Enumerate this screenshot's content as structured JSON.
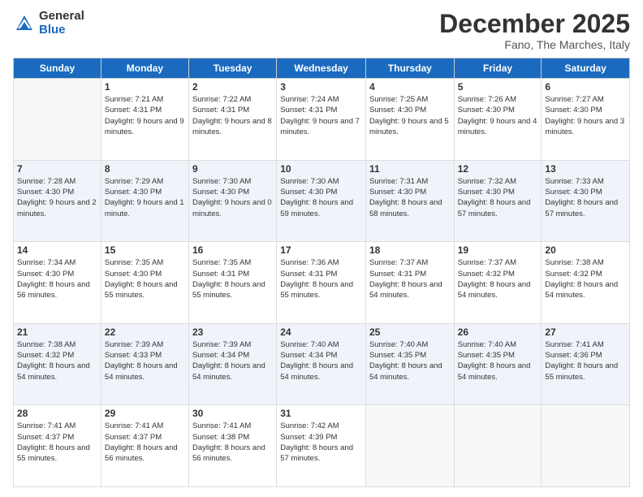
{
  "logo": {
    "general": "General",
    "blue": "Blue"
  },
  "header": {
    "month": "December 2025",
    "location": "Fano, The Marches, Italy"
  },
  "weekdays": [
    "Sunday",
    "Monday",
    "Tuesday",
    "Wednesday",
    "Thursday",
    "Friday",
    "Saturday"
  ],
  "weeks": [
    [
      {
        "day": "",
        "sunrise": "",
        "sunset": "",
        "daylight": ""
      },
      {
        "day": "1",
        "sunrise": "Sunrise: 7:21 AM",
        "sunset": "Sunset: 4:31 PM",
        "daylight": "Daylight: 9 hours and 9 minutes."
      },
      {
        "day": "2",
        "sunrise": "Sunrise: 7:22 AM",
        "sunset": "Sunset: 4:31 PM",
        "daylight": "Daylight: 9 hours and 8 minutes."
      },
      {
        "day": "3",
        "sunrise": "Sunrise: 7:24 AM",
        "sunset": "Sunset: 4:31 PM",
        "daylight": "Daylight: 9 hours and 7 minutes."
      },
      {
        "day": "4",
        "sunrise": "Sunrise: 7:25 AM",
        "sunset": "Sunset: 4:30 PM",
        "daylight": "Daylight: 9 hours and 5 minutes."
      },
      {
        "day": "5",
        "sunrise": "Sunrise: 7:26 AM",
        "sunset": "Sunset: 4:30 PM",
        "daylight": "Daylight: 9 hours and 4 minutes."
      },
      {
        "day": "6",
        "sunrise": "Sunrise: 7:27 AM",
        "sunset": "Sunset: 4:30 PM",
        "daylight": "Daylight: 9 hours and 3 minutes."
      }
    ],
    [
      {
        "day": "7",
        "sunrise": "Sunrise: 7:28 AM",
        "sunset": "Sunset: 4:30 PM",
        "daylight": "Daylight: 9 hours and 2 minutes."
      },
      {
        "day": "8",
        "sunrise": "Sunrise: 7:29 AM",
        "sunset": "Sunset: 4:30 PM",
        "daylight": "Daylight: 9 hours and 1 minute."
      },
      {
        "day": "9",
        "sunrise": "Sunrise: 7:30 AM",
        "sunset": "Sunset: 4:30 PM",
        "daylight": "Daylight: 9 hours and 0 minutes."
      },
      {
        "day": "10",
        "sunrise": "Sunrise: 7:30 AM",
        "sunset": "Sunset: 4:30 PM",
        "daylight": "Daylight: 8 hours and 59 minutes."
      },
      {
        "day": "11",
        "sunrise": "Sunrise: 7:31 AM",
        "sunset": "Sunset: 4:30 PM",
        "daylight": "Daylight: 8 hours and 58 minutes."
      },
      {
        "day": "12",
        "sunrise": "Sunrise: 7:32 AM",
        "sunset": "Sunset: 4:30 PM",
        "daylight": "Daylight: 8 hours and 57 minutes."
      },
      {
        "day": "13",
        "sunrise": "Sunrise: 7:33 AM",
        "sunset": "Sunset: 4:30 PM",
        "daylight": "Daylight: 8 hours and 57 minutes."
      }
    ],
    [
      {
        "day": "14",
        "sunrise": "Sunrise: 7:34 AM",
        "sunset": "Sunset: 4:30 PM",
        "daylight": "Daylight: 8 hours and 56 minutes."
      },
      {
        "day": "15",
        "sunrise": "Sunrise: 7:35 AM",
        "sunset": "Sunset: 4:30 PM",
        "daylight": "Daylight: 8 hours and 55 minutes."
      },
      {
        "day": "16",
        "sunrise": "Sunrise: 7:35 AM",
        "sunset": "Sunset: 4:31 PM",
        "daylight": "Daylight: 8 hours and 55 minutes."
      },
      {
        "day": "17",
        "sunrise": "Sunrise: 7:36 AM",
        "sunset": "Sunset: 4:31 PM",
        "daylight": "Daylight: 8 hours and 55 minutes."
      },
      {
        "day": "18",
        "sunrise": "Sunrise: 7:37 AM",
        "sunset": "Sunset: 4:31 PM",
        "daylight": "Daylight: 8 hours and 54 minutes."
      },
      {
        "day": "19",
        "sunrise": "Sunrise: 7:37 AM",
        "sunset": "Sunset: 4:32 PM",
        "daylight": "Daylight: 8 hours and 54 minutes."
      },
      {
        "day": "20",
        "sunrise": "Sunrise: 7:38 AM",
        "sunset": "Sunset: 4:32 PM",
        "daylight": "Daylight: 8 hours and 54 minutes."
      }
    ],
    [
      {
        "day": "21",
        "sunrise": "Sunrise: 7:38 AM",
        "sunset": "Sunset: 4:32 PM",
        "daylight": "Daylight: 8 hours and 54 minutes."
      },
      {
        "day": "22",
        "sunrise": "Sunrise: 7:39 AM",
        "sunset": "Sunset: 4:33 PM",
        "daylight": "Daylight: 8 hours and 54 minutes."
      },
      {
        "day": "23",
        "sunrise": "Sunrise: 7:39 AM",
        "sunset": "Sunset: 4:34 PM",
        "daylight": "Daylight: 8 hours and 54 minutes."
      },
      {
        "day": "24",
        "sunrise": "Sunrise: 7:40 AM",
        "sunset": "Sunset: 4:34 PM",
        "daylight": "Daylight: 8 hours and 54 minutes."
      },
      {
        "day": "25",
        "sunrise": "Sunrise: 7:40 AM",
        "sunset": "Sunset: 4:35 PM",
        "daylight": "Daylight: 8 hours and 54 minutes."
      },
      {
        "day": "26",
        "sunrise": "Sunrise: 7:40 AM",
        "sunset": "Sunset: 4:35 PM",
        "daylight": "Daylight: 8 hours and 54 minutes."
      },
      {
        "day": "27",
        "sunrise": "Sunrise: 7:41 AM",
        "sunset": "Sunset: 4:36 PM",
        "daylight": "Daylight: 8 hours and 55 minutes."
      }
    ],
    [
      {
        "day": "28",
        "sunrise": "Sunrise: 7:41 AM",
        "sunset": "Sunset: 4:37 PM",
        "daylight": "Daylight: 8 hours and 55 minutes."
      },
      {
        "day": "29",
        "sunrise": "Sunrise: 7:41 AM",
        "sunset": "Sunset: 4:37 PM",
        "daylight": "Daylight: 8 hours and 56 minutes."
      },
      {
        "day": "30",
        "sunrise": "Sunrise: 7:41 AM",
        "sunset": "Sunset: 4:38 PM",
        "daylight": "Daylight: 8 hours and 56 minutes."
      },
      {
        "day": "31",
        "sunrise": "Sunrise: 7:42 AM",
        "sunset": "Sunset: 4:39 PM",
        "daylight": "Daylight: 8 hours and 57 minutes."
      },
      {
        "day": "",
        "sunrise": "",
        "sunset": "",
        "daylight": ""
      },
      {
        "day": "",
        "sunrise": "",
        "sunset": "",
        "daylight": ""
      },
      {
        "day": "",
        "sunrise": "",
        "sunset": "",
        "daylight": ""
      }
    ]
  ]
}
